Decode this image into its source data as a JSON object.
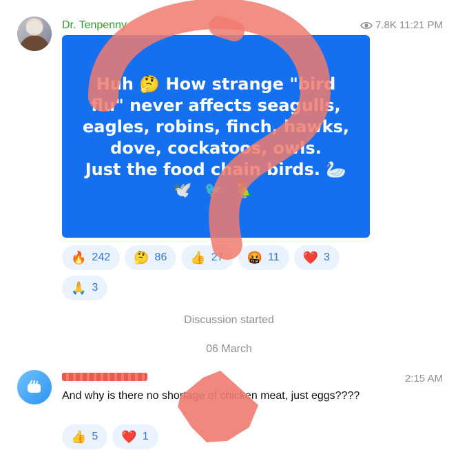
{
  "post": {
    "author": "Dr. Tenpenny",
    "views": "7.8K",
    "time": "11:21 PM",
    "media_text_lines": [
      "Huh 🤔 How strange \"bird",
      "flu\" never affects seagulls,",
      "eagles, robins, finch, hawks,",
      "dove, cockatoos, owls.",
      "Just the food chain birds. 🦢"
    ],
    "media_emoji": "🕊️ 🐦 🦜",
    "reactions": [
      {
        "emoji": "🔥",
        "count": "242"
      },
      {
        "emoji": "🤔",
        "count": "86"
      },
      {
        "emoji": "👍",
        "count": "27"
      },
      {
        "emoji": "🤬",
        "count": "11"
      },
      {
        "emoji": "❤️",
        "count": "3"
      },
      {
        "emoji": "🙏",
        "count": "3"
      }
    ]
  },
  "service": {
    "discussion": "Discussion started",
    "date": "06 March"
  },
  "comment": {
    "time": "2:15 AM",
    "text": "And why is there no shortage of chicken meat, just eggs????",
    "reactions": [
      {
        "emoji": "👍",
        "count": "5"
      },
      {
        "emoji": "❤️",
        "count": "1"
      }
    ]
  },
  "colors": {
    "author": "#2e9b2e",
    "media_bg": "#1570ef",
    "reaction_bg": "#e9f2fd",
    "reaction_text": "#2f76d2",
    "annotation": "#f07b70"
  },
  "icons": [
    "eye-icon",
    "question-mark-overlay",
    "scribble-overlay"
  ]
}
